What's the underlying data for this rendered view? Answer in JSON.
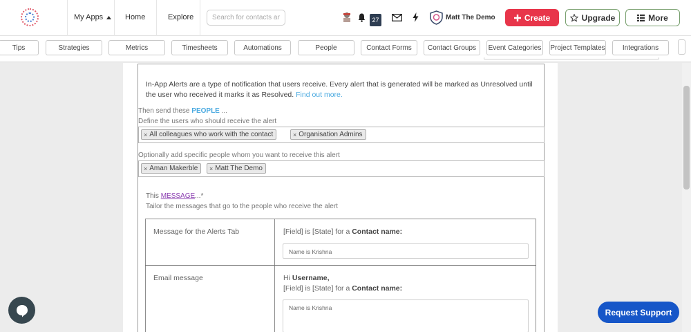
{
  "topbar": {
    "my_apps": "My Apps",
    "home": "Home",
    "explore": "Explore",
    "search_placeholder": "Search for contacts and...",
    "notification_count": "27",
    "user_name": "Matt The Demo",
    "create_label": "Create",
    "upgrade_label": "Upgrade",
    "more_label": "More"
  },
  "tabs": [
    "Tips",
    "Strategies",
    "Metrics",
    "Timesheets",
    "Automations",
    "People",
    "Contact Forms",
    "Contact Groups",
    "Event Categories",
    "Project Templates",
    "Integrations"
  ],
  "alerts": {
    "intro_text": "In-App Alerts are a type of notification that users receive. Every alert that is generated will be marked as Unresolved until the user who received it marks it as Resolved.",
    "intro_link": "Find out more.",
    "people_prefix": "Then send these",
    "people_keyword": "PEOPLE",
    "people_suffix": "...",
    "people_help": "Define the users who should receive the alert",
    "users_tags": [
      "All colleagues who work with the contact",
      "Organisation Admins"
    ],
    "specific_help": "Optionally add specific people whom you want to receive this alert",
    "specific_tags": [
      "Aman Makerble",
      "Matt The Demo"
    ],
    "message_prefix": "This",
    "message_keyword": "MESSAGE",
    "message_suffix": "...*",
    "message_help": "Tailor the messages that go to the people who receive the alert"
  },
  "messages": {
    "alerts_tab_label": "Message for the Alerts Tab",
    "alerts_tab_template_plain": "[Field] is [State] for a",
    "alerts_tab_template_bold": "Contact name:",
    "alerts_tab_value": "Name is Krishna",
    "email_label": "Email message",
    "email_greeting_plain": "Hi",
    "email_greeting_bold": "Username,",
    "email_template_plain": "[Field] is [State] for a",
    "email_template_bold": "Contact name:",
    "email_value": "Name is Krishna"
  },
  "support": {
    "label": "Request Support"
  },
  "colors": {
    "create": "#e8354a",
    "support": "#1656c8",
    "link": "#49a9e0",
    "message_keyword": "#8a3cb0",
    "badge": "#2e3d52"
  },
  "icons": [
    "logo-icon",
    "caret-up-icon",
    "profile-icon",
    "bell-icon",
    "mail-icon",
    "bolt-icon",
    "shield-avatar-icon",
    "plus-icon",
    "star-icon",
    "list-icon",
    "close-icon",
    "chat-icon"
  ]
}
